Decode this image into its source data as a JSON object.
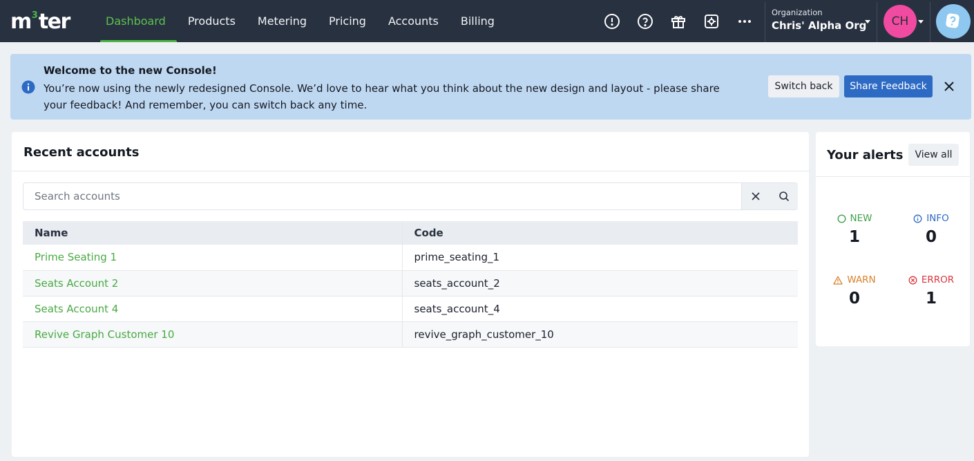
{
  "nav": {
    "logo_main": "m",
    "logo_sup": "3",
    "logo_rest": "ter",
    "tabs": [
      {
        "label": "Dashboard",
        "active": true
      },
      {
        "label": "Products"
      },
      {
        "label": "Metering"
      },
      {
        "label": "Pricing"
      },
      {
        "label": "Accounts"
      },
      {
        "label": "Billing"
      }
    ],
    "icons": [
      "alert-circle-icon",
      "help-circle-icon",
      "gift-icon",
      "settings-cog-icon",
      "more-dots-icon"
    ],
    "org_label": "Organization",
    "org_name": "Chris' Alpha Org",
    "avatar_initials": "CH"
  },
  "banner": {
    "title": "Welcome to the new Console!",
    "text": "You’re now using the newly redesigned Console. We’d love to hear what you think about the new design and layout - please share your feedback! And remember, you can switch back any time.",
    "switch_back": "Switch back",
    "share_feedback": "Share Feedback"
  },
  "accounts": {
    "title": "Recent accounts",
    "search_placeholder": "Search accounts",
    "columns": [
      "Name",
      "Code"
    ],
    "rows": [
      {
        "name": "Prime Seating 1",
        "code": "prime_seating_1"
      },
      {
        "name": "Seats Account 2",
        "code": "seats_account_2"
      },
      {
        "name": "Seats Account 4",
        "code": "seats_account_4"
      },
      {
        "name": "Revive Graph Customer 10",
        "code": "revive_graph_customer_10"
      }
    ]
  },
  "alerts": {
    "title": "Your alerts",
    "view_all": "View all",
    "items": [
      {
        "label": "NEW",
        "count": "1",
        "color": "#3fa14a"
      },
      {
        "label": "INFO",
        "count": "0",
        "color": "#2d6ac4"
      },
      {
        "label": "WARN",
        "count": "0",
        "color": "#d9822b"
      },
      {
        "label": "ERROR",
        "count": "1",
        "color": "#d9363e"
      }
    ]
  },
  "colors": {
    "nav_bg": "#283140",
    "brand_green": "#4cb648",
    "banner_bg": "#bfd8f1",
    "primary_blue": "#2d6ac4",
    "avatar_pink": "#f04ba0"
  }
}
